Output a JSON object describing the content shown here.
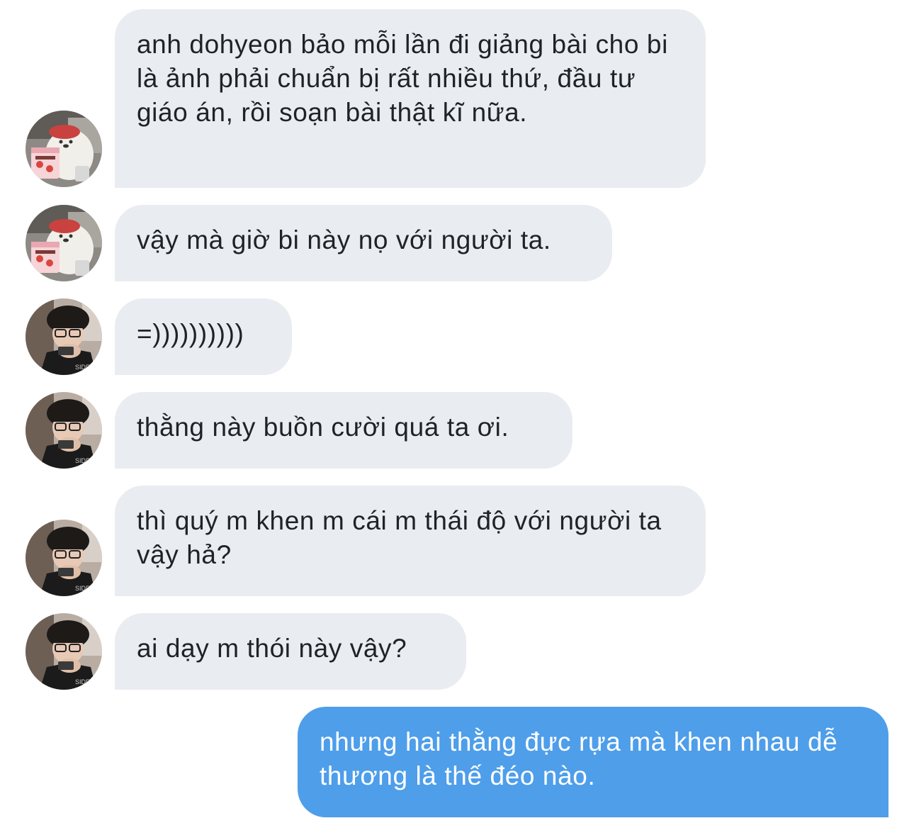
{
  "colors": {
    "incoming_bubble": "#e9ecf0",
    "incoming_text": "#1f2328",
    "outgoing_bubble": "#4e9eea",
    "outgoing_text": "#ffffff"
  },
  "messages": [
    {
      "sender": "friend-bear",
      "text": "anh dohyeon bảo mỗi lần đi giảng bài cho bi là ảnh phải chuẩn bị rất nhiều thứ, đầu tư giáo án, rồi soạn bài thật kĩ nữa."
    },
    {
      "sender": "friend-bear",
      "text": "vậy mà giờ bi này nọ với người ta."
    },
    {
      "sender": "friend-boy",
      "text": "=))))))))))"
    },
    {
      "sender": "friend-boy",
      "text": "thằng này buồn cười quá ta ơi."
    },
    {
      "sender": "friend-boy",
      "text": "thì quý m khen m cái m thái độ với người ta vậy hả?"
    },
    {
      "sender": "friend-boy",
      "text": "ai dạy m thói này vậy?"
    },
    {
      "sender": "me",
      "text": "nhưng hai thằng đực rựa mà khen nhau dễ thương là thế đéo nào."
    }
  ],
  "avatars": {
    "friend-bear": "bear-icecream-avatar",
    "friend-boy": "boy-phone-avatar"
  }
}
